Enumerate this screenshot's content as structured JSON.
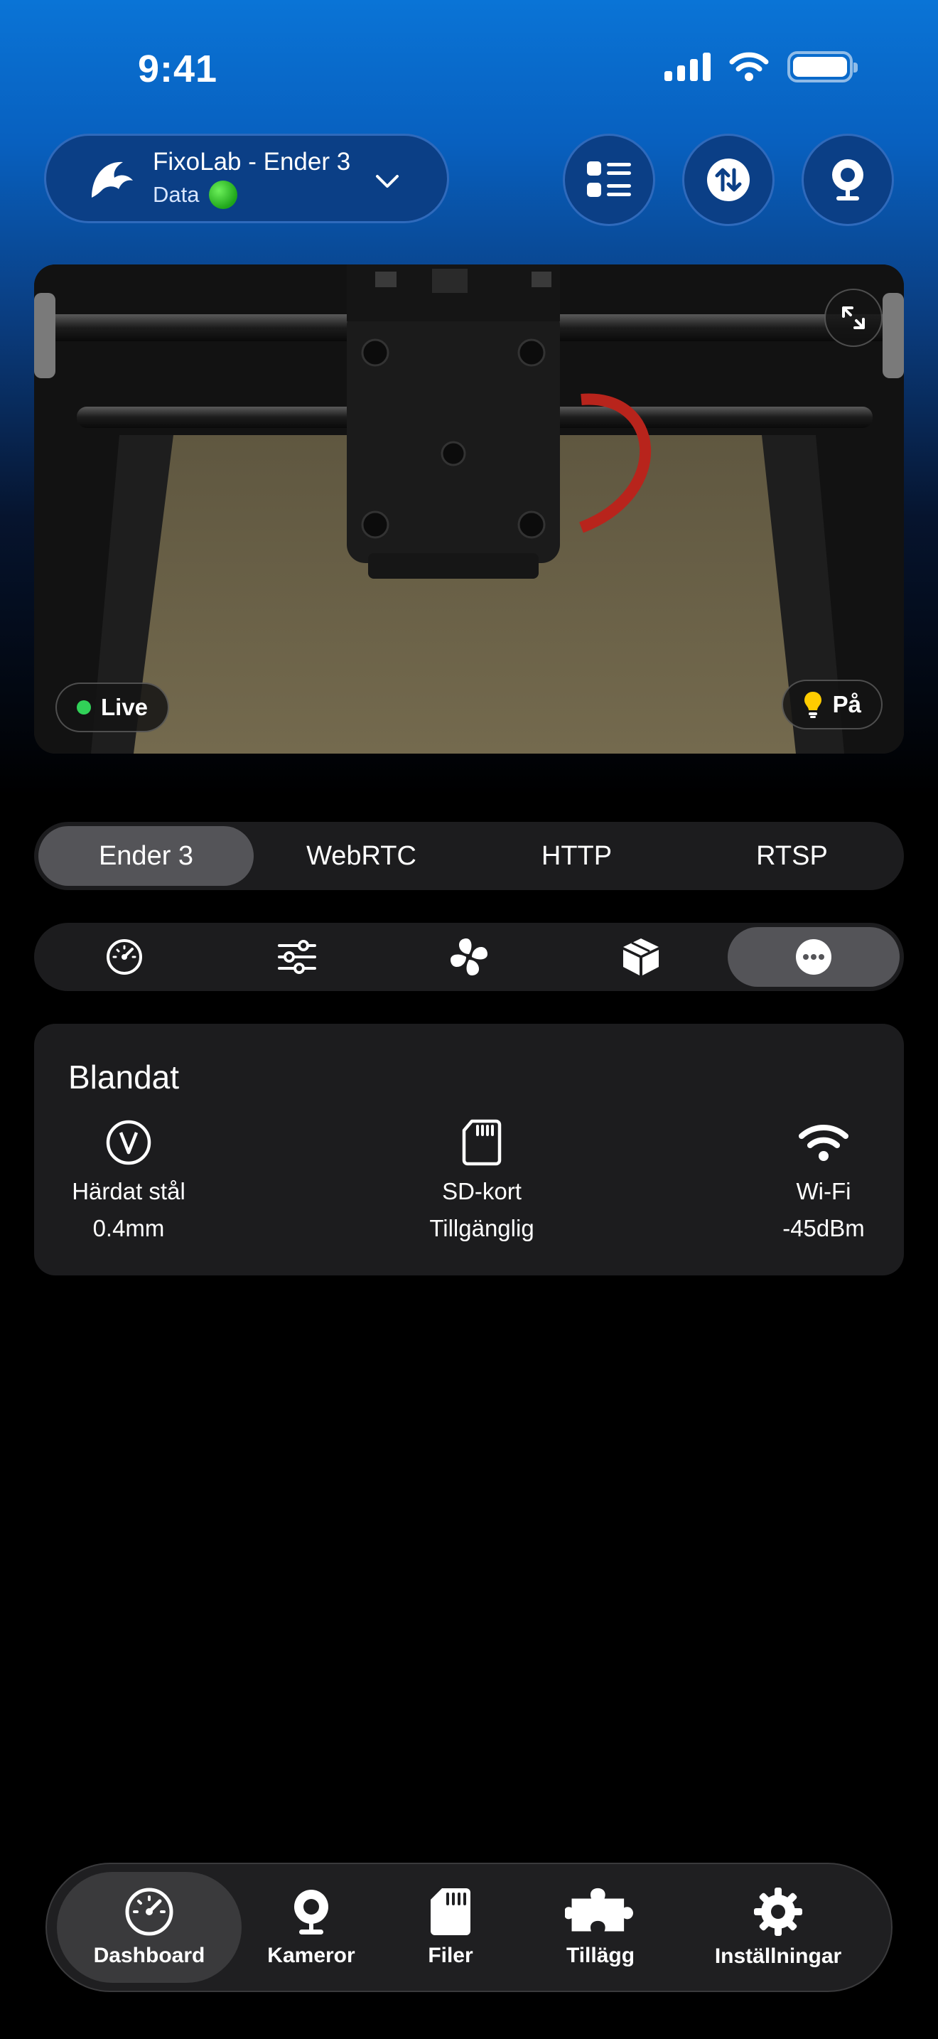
{
  "status_bar": {
    "time": "9:41",
    "icons": [
      "cellular-signal-icon",
      "wifi-icon",
      "battery-icon"
    ]
  },
  "printer_selector": {
    "name": "FixoLab - Ender 3",
    "subtitle": "Data",
    "status_color": "#22c322"
  },
  "header_actions": [
    "list-icon",
    "transfer-icon",
    "webcam-icon"
  ],
  "camera": {
    "live_label": "Live",
    "light_label": "På"
  },
  "sources": {
    "items": [
      "Ender 3",
      "WebRTC",
      "HTTP",
      "RTSP"
    ],
    "active": 0
  },
  "tool_tabs": {
    "items": [
      "dashboard-gauge-icon",
      "sliders-icon",
      "fan-icon",
      "cube-icon",
      "more-icon"
    ],
    "active": 4
  },
  "info_card": {
    "title": "Blandat",
    "items": [
      {
        "icon": "nozzle-v-icon",
        "label": "Härdat stål",
        "value": "0.4mm"
      },
      {
        "icon": "sd-card-icon",
        "label": "SD-kort",
        "value": "Tillgänglig"
      },
      {
        "icon": "wifi-icon",
        "label": "Wi-Fi",
        "value": "-45dBm"
      }
    ]
  },
  "bottom_nav": {
    "items": [
      {
        "label": "Dashboard",
        "icon": "dashboard-gauge-icon"
      },
      {
        "label": "Kameror",
        "icon": "webcam-icon"
      },
      {
        "label": "Filer",
        "icon": "file-icon"
      },
      {
        "label": "Tillägg",
        "icon": "puzzle-icon"
      },
      {
        "label": "Inställningar",
        "icon": "gear-icon"
      }
    ],
    "active": 0
  },
  "colors": {
    "accent_blue": "#0a74d6",
    "live_green": "#31d158",
    "card_bg": "#1c1c1e",
    "segment_active": "#545458"
  }
}
